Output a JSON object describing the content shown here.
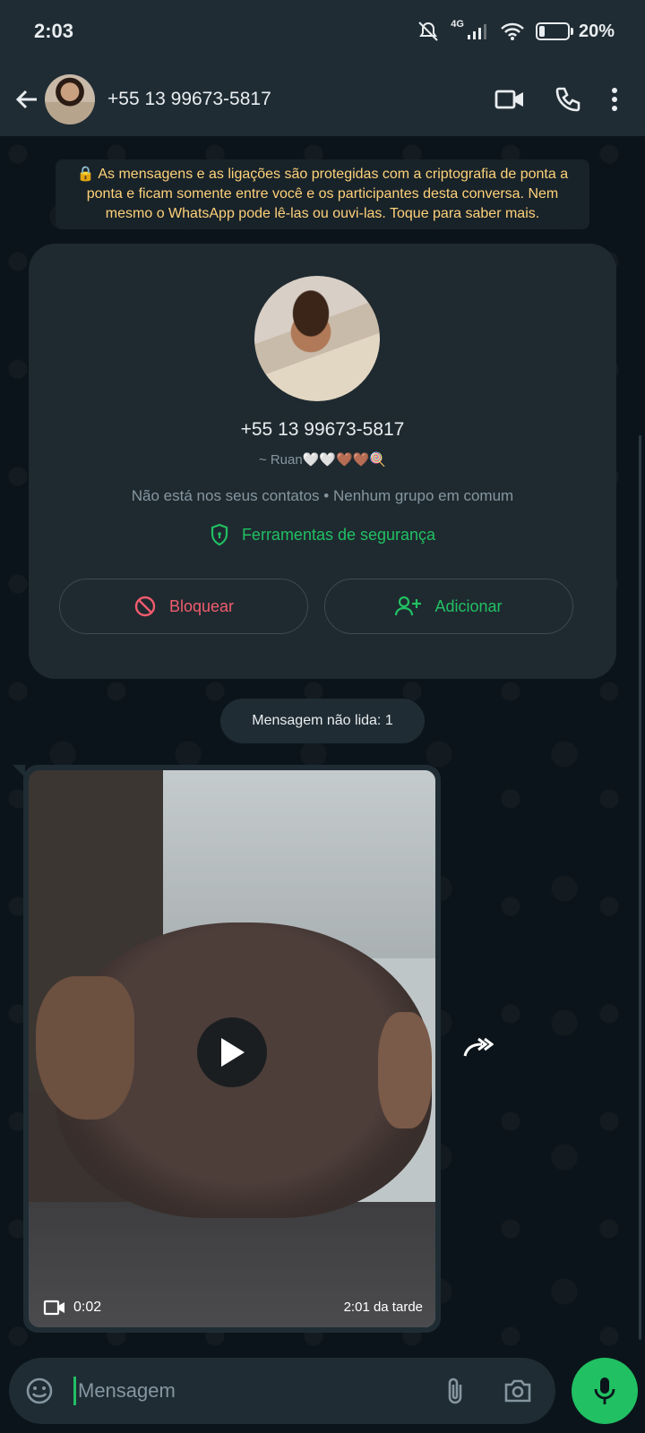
{
  "status_bar": {
    "time": "2:03",
    "network": "4G",
    "battery": "20%",
    "battery_level": 0.2
  },
  "header": {
    "contact_name": "+55 13 99673-5817"
  },
  "encryption_notice": "🔒 As mensagens e as ligações são protegidas com a criptografia de ponta a ponta e ficam somente entre você e os participantes desta conversa. Nem mesmo o WhatsApp pode lê-las ou ouvi-las. Toque para saber mais.",
  "contact_card": {
    "phone": "+55 13 99673-5817",
    "username": "~ Ruan🤍🤍🤎🤎🍭",
    "info": "Não está nos seus contatos  •  Nenhum grupo em comum",
    "security_label": "Ferramentas de segurança",
    "block_label": "Bloquear",
    "add_label": "Adicionar"
  },
  "unread_label": "Mensagem não lida: 1",
  "video_message": {
    "duration": "0:02",
    "time": "2:01 da tarde"
  },
  "input": {
    "placeholder": "Mensagem"
  },
  "colors": {
    "accent": "#21c063",
    "danger": "#f15c6d",
    "notice": "#ffd279",
    "header_bg": "#1f2c34"
  },
  "icons": [
    "back-arrow-icon",
    "video-call-icon",
    "phone-icon",
    "more-vert-icon",
    "shield-icon",
    "block-icon",
    "add-person-icon",
    "play-icon",
    "video-camera-icon",
    "forward-icon",
    "emoji-icon",
    "attach-icon",
    "camera-icon",
    "mic-icon"
  ]
}
